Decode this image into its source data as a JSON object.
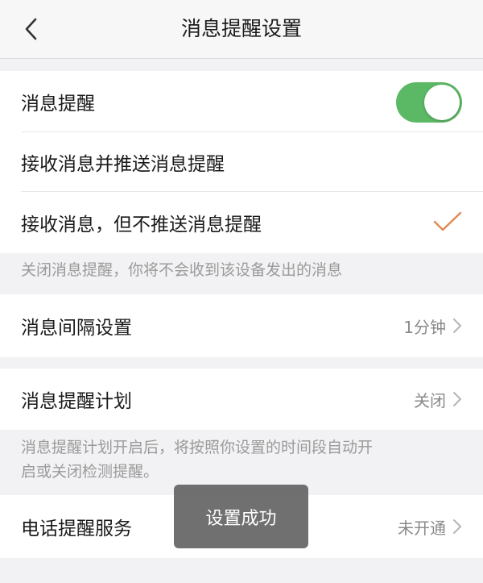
{
  "header": {
    "title": "消息提醒设置",
    "back_icon": "chevron-left-icon"
  },
  "notification": {
    "label": "消息提醒",
    "toggle_on": true,
    "toggle_color": "#5bb865"
  },
  "options": [
    {
      "label": "接收消息并推送消息提醒",
      "selected": false
    },
    {
      "label": "接收消息，但不推送消息提醒",
      "selected": true
    }
  ],
  "check_color": "#e08a55",
  "hint_notification_off": "关闭消息提醒，你将不会收到该设备发出的消息",
  "interval": {
    "label": "消息间隔设置",
    "value": "1分钟"
  },
  "schedule": {
    "label": "消息提醒计划",
    "value": "关闭"
  },
  "hint_schedule_lines": [
    "消息提醒计划开启后，将按照你设置的时间段自动开",
    "启或关闭检测提醒。"
  ],
  "phone": {
    "label": "电话提醒服务",
    "value": "未开通"
  },
  "toast": {
    "text": "设置成功"
  }
}
